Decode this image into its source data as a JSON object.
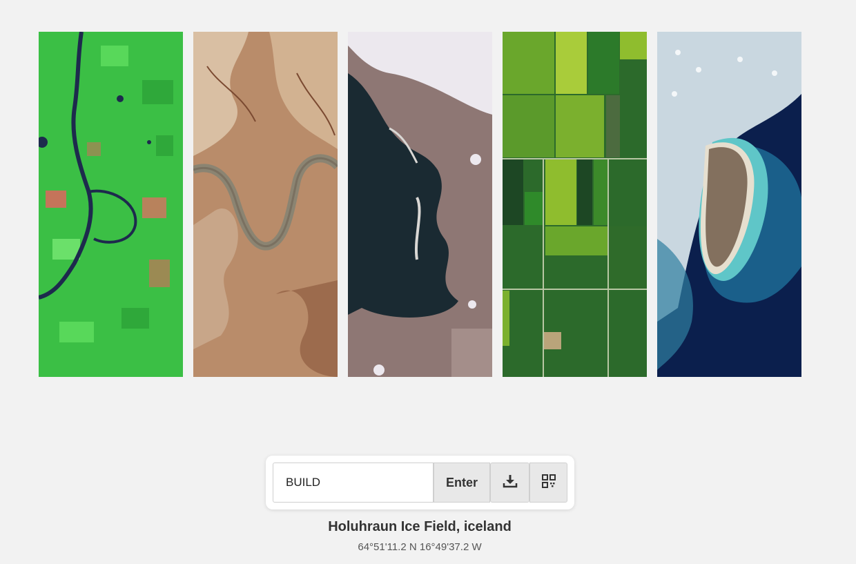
{
  "gallery": {
    "images": [
      {
        "name": "green-river-farmland-satellite-image",
        "palette": {
          "base": "#3bbf45",
          "field": "#58d85a",
          "accent": "#c5745a",
          "river": "#1d2a4d"
        }
      },
      {
        "name": "desert-canyon-river-satellite-image",
        "palette": {
          "base": "#b98c6a",
          "light": "#d9bfa3",
          "dark": "#7b4a31",
          "river": "#8b8472"
        }
      },
      {
        "name": "dark-lake-coastline-satellite-image",
        "palette": {
          "base": "#1a2a32",
          "land": "#8e7774",
          "snow": "#ece8ee",
          "shore": "#d9d7d4"
        }
      },
      {
        "name": "green-crop-fields-satellite-image",
        "palette": {
          "base": "#2c6a2b",
          "light": "#8fbd2e",
          "mid": "#3c8a2a",
          "dark": "#1d4724",
          "road": "#b9c7a4"
        }
      },
      {
        "name": "island-turquoise-sea-satellite-image",
        "palette": {
          "base": "#0b1f4d",
          "sea": "#1a5f8a",
          "turquoise": "#5fc6c8",
          "sand": "#e6dfcf",
          "island": "#83705e"
        }
      }
    ]
  },
  "controls": {
    "word_value": "BUILD",
    "enter_label": "Enter",
    "download_icon": "download-icon",
    "qr_icon": "qr-code-icon"
  },
  "location": {
    "title": "Holuhraun Ice Field, iceland",
    "coordinates": "64°51'11.2 N 16°49'37.2 W"
  }
}
